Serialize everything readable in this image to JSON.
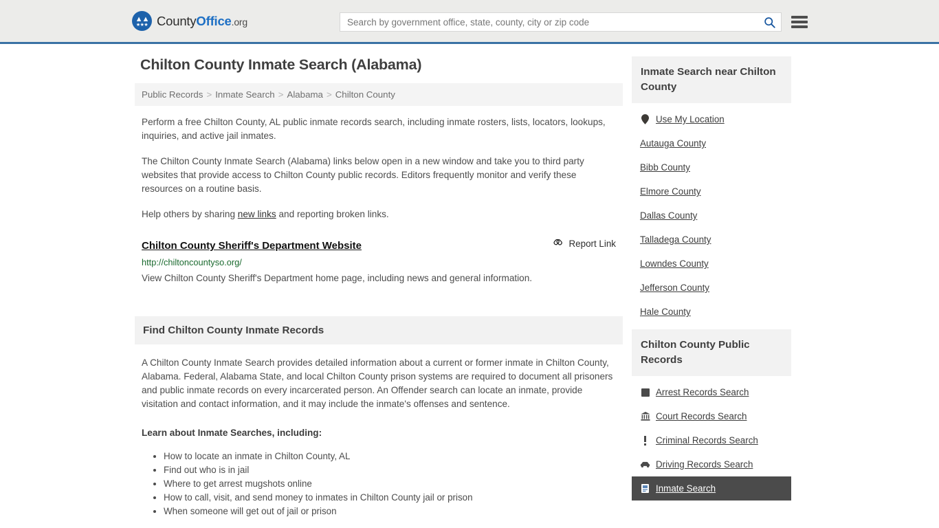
{
  "header": {
    "brand": {
      "part1": "County",
      "part2": "Office",
      "part3": ".org"
    },
    "search": {
      "placeholder": "Search by government office, state, county, city or zip code",
      "value": ""
    },
    "menu_label": "Menu"
  },
  "main": {
    "title": "Chilton County Inmate Search (Alabama)",
    "breadcrumb": [
      "Public Records",
      "Inmate Search",
      "Alabama",
      "Chilton County"
    ],
    "breadcrumb_separator": ">",
    "intro_1": "Perform a free Chilton County, AL public inmate records search, including inmate rosters, lists, locators, lookups, inquiries, and active jail inmates.",
    "intro_2": "The Chilton County Inmate Search (Alabama) links below open in a new window and take you to third party websites that provide access to Chilton County public records. Editors frequently monitor and verify these resources on a routine basis.",
    "intro_3_pre": "Help others by sharing ",
    "intro_3_link": "new links",
    "intro_3_post": " and reporting broken links.",
    "link_entry": {
      "title": "Chilton County Sheriff's Department Website",
      "report_label": "Report Link",
      "url": "http://chiltoncountyso.org/",
      "description": "View Chilton County Sheriff's Department home page, including news and general information."
    },
    "section": {
      "heading": "Find Chilton County Inmate Records",
      "paragraph": "A Chilton County Inmate Search provides detailed information about a current or former inmate in Chilton County, Alabama. Federal, Alabama State, and local Chilton County prison systems are required to document all prisoners and public inmate records on every incarcerated person. An Offender search can locate an inmate, provide visitation and contact information, and it may include the inmate's offenses and sentence.",
      "list_heading": "Learn about Inmate Searches, including:",
      "items": [
        "How to locate an inmate in Chilton County, AL",
        "Find out who is in jail",
        "Where to get arrest mugshots online",
        "How to call, visit, and send money to inmates in Chilton County jail or prison",
        "When someone will get out of jail or prison"
      ]
    }
  },
  "sidebar": {
    "nearby": {
      "heading": "Inmate Search near Chilton County",
      "items": [
        {
          "label": "Use My Location",
          "icon": "map-pin-icon"
        },
        {
          "label": "Autauga County",
          "icon": ""
        },
        {
          "label": "Bibb County",
          "icon": ""
        },
        {
          "label": "Elmore County",
          "icon": ""
        },
        {
          "label": "Dallas County",
          "icon": ""
        },
        {
          "label": "Talladega County",
          "icon": ""
        },
        {
          "label": "Lowndes County",
          "icon": ""
        },
        {
          "label": "Jefferson County",
          "icon": ""
        },
        {
          "label": "Hale County",
          "icon": ""
        }
      ]
    },
    "public_records": {
      "heading": "Chilton County Public Records",
      "items": [
        {
          "label": "Arrest Records Search",
          "icon": "fingerprint-icon",
          "active": false
        },
        {
          "label": "Court Records Search",
          "icon": "bank-icon",
          "active": false
        },
        {
          "label": "Criminal Records Search",
          "icon": "exclamation-icon",
          "active": false
        },
        {
          "label": "Driving Records Search",
          "icon": "car-icon",
          "active": false
        },
        {
          "label": "Inmate Search",
          "icon": "id-card-icon",
          "active": true
        }
      ]
    }
  },
  "colors": {
    "brand_blue": "#1d6fc4",
    "header_bg": "#ececea",
    "header_border": "#3a72a4",
    "url_green": "#1b6a2f",
    "active_bg": "#4b4b4b",
    "panel_bg": "#f2f2f2"
  }
}
